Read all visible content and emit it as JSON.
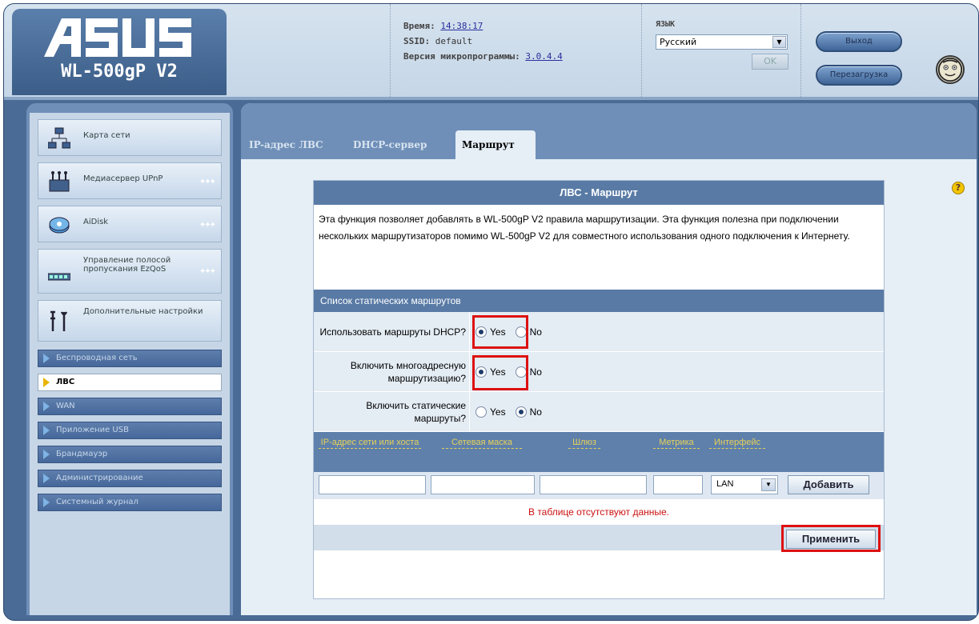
{
  "header": {
    "brand": "ASUS",
    "model": "WL-500gP V2",
    "time_label": "Время:",
    "time_value": "14:38:17",
    "ssid_label": "SSID:",
    "ssid_value": "default",
    "firmware_label": "Версия микропрограммы:",
    "firmware_value": "3.0.4.4",
    "language_label": "ЯЗЫК",
    "language_value": "Русский",
    "ok_label": "OK",
    "logout_label": "Выход",
    "reboot_label": "Перезагрузка"
  },
  "sidebar": {
    "main_items": [
      {
        "label": "Карта сети"
      },
      {
        "label": "Медиасервер UPnP"
      },
      {
        "label": "AiDisk"
      },
      {
        "label": "Управление полосой пропускания EzQoS"
      },
      {
        "label": "Дополнительные настройки"
      }
    ],
    "sub_items": [
      {
        "label": "Беспроводная сеть"
      },
      {
        "label": "ЛВС"
      },
      {
        "label": "WAN"
      },
      {
        "label": "Приложение USB"
      },
      {
        "label": "Брандмауэр"
      },
      {
        "label": "Администрирование"
      },
      {
        "label": "Системный журнал"
      }
    ]
  },
  "tabs": [
    {
      "label": "IP-адрес ЛВС"
    },
    {
      "label": "DHCP-сервер"
    },
    {
      "label": "Маршрут"
    }
  ],
  "content": {
    "title": "ЛВС - Маршрут",
    "description": "Эта функция позволяет добавлять в WL-500gP V2 правила маршрутизации. Эта функция полезна при подключении нескольких маршрутизаторов помимо WL-500gP V2 для совместного использования одного подключения к Интернету.",
    "list_title": "Список статических маршрутов",
    "options": [
      {
        "label": "Использовать маршруты DHCP?",
        "selected": "Yes"
      },
      {
        "label": "Включить многоадресную маршрутизацию?",
        "selected": "Yes"
      },
      {
        "label": "Включить статические маршруты?",
        "selected": "No"
      }
    ],
    "yes_label": "Yes",
    "no_label": "No",
    "columns": [
      "IP-адрес сети или хоста",
      "Сетевая маска",
      "Шлюз",
      "Метрика",
      "Интерфейс"
    ],
    "interface_value": "LAN",
    "add_label": "Добавить",
    "empty_message": "В таблице отсутствуют данные.",
    "apply_label": "Применить"
  },
  "colors": {
    "accent": "#587aa5",
    "highlight": "#d11111"
  }
}
